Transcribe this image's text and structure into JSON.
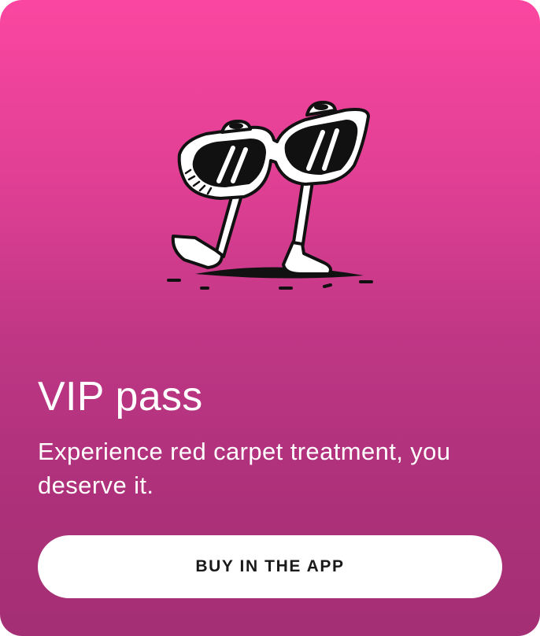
{
  "card": {
    "title": "VIP pass",
    "description": "Experience red carpet treatment, you deserve it.",
    "cta_label": "BUY IN THE APP",
    "illustration": "walking-sunglasses-illustration"
  },
  "colors": {
    "gradient_top": "#fb46a0",
    "gradient_bottom": "#a42f74",
    "text": "#ffffff",
    "button_bg": "#ffffff",
    "button_text": "#1a1a1a"
  }
}
